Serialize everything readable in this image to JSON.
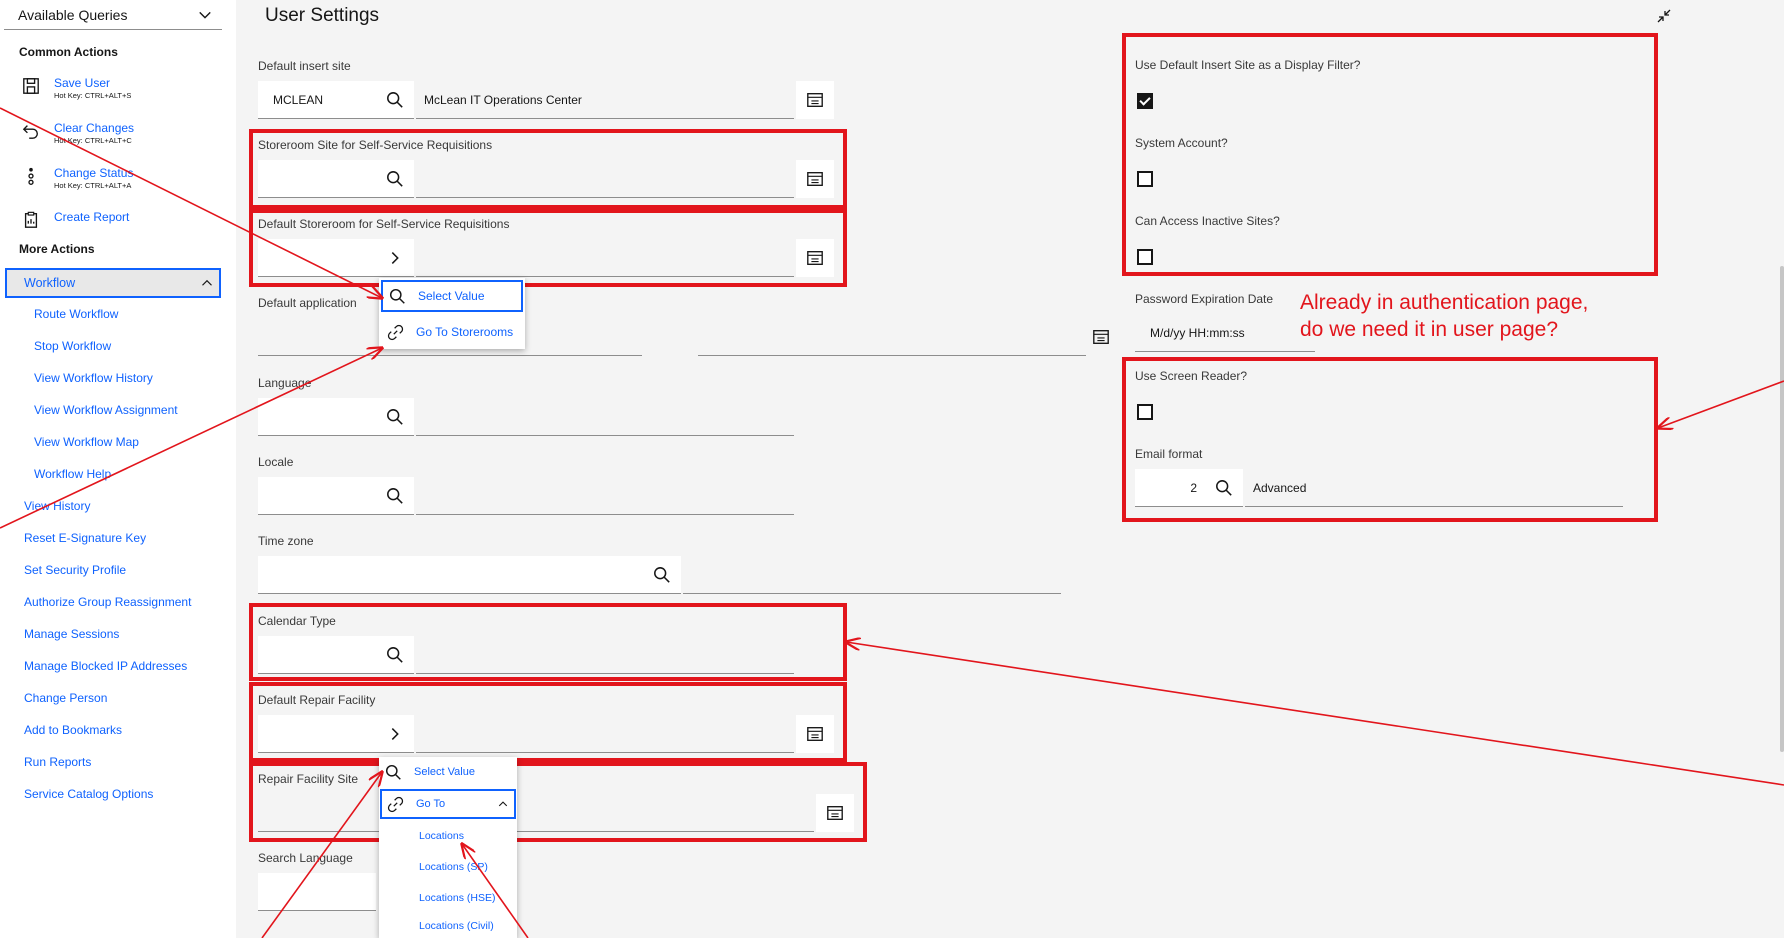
{
  "sidebar": {
    "available_queries": "Available Queries",
    "common_actions_title": "Common Actions",
    "common_actions": [
      {
        "label": "Save User",
        "hotkey": "Hot Key: CTRL+ALT+S",
        "icon": "save-icon"
      },
      {
        "label": "Clear Changes",
        "hotkey": "Hot Key: CTRL+ALT+C",
        "icon": "undo-icon"
      },
      {
        "label": "Change Status",
        "hotkey": "Hot Key: CTRL+ALT+A",
        "icon": "status-icon"
      },
      {
        "label": "Create Report",
        "hotkey": "",
        "icon": "report-icon"
      }
    ],
    "more_actions_title": "More Actions",
    "workflow": {
      "label": "Workflow",
      "items": [
        "Route Workflow",
        "Stop Workflow",
        "View Workflow History",
        "View Workflow Assignment",
        "View Workflow Map",
        "Workflow Help"
      ]
    },
    "more_actions": [
      "View History",
      "Reset E-Signature Key",
      "Set Security Profile",
      "Authorize Group Reassignment",
      "Manage Sessions",
      "Manage Blocked IP Addresses",
      "Change Person",
      "Add to Bookmarks",
      "Run Reports",
      "Service Catalog Options"
    ]
  },
  "main": {
    "title": "User Settings",
    "default_insert_site": {
      "label": "Default insert site",
      "value": "MCLEAN",
      "description": "McLean IT Operations Center"
    },
    "storeroom_site": {
      "label": "Storeroom Site for Self-Service Requisitions",
      "value": ""
    },
    "default_storeroom": {
      "label": "Default Storeroom for Self-Service Requisitions",
      "value": ""
    },
    "default_application": {
      "label": "Default application",
      "value": ""
    },
    "language": {
      "label": "Language",
      "value": ""
    },
    "locale": {
      "label": "Locale",
      "value": ""
    },
    "time_zone": {
      "label": "Time zone",
      "value": ""
    },
    "calendar_type": {
      "label": "Calendar Type",
      "value": ""
    },
    "default_repair_facility": {
      "label": "Default Repair Facility",
      "value": ""
    },
    "repair_facility_site": {
      "label": "Repair Facility Site",
      "value": ""
    },
    "search_language": {
      "label": "Search Language",
      "value": ""
    },
    "storeroom_menu": {
      "select_value": "Select Value",
      "go_to": "Go To Storerooms"
    },
    "repair_menu": {
      "select_value": "Select Value",
      "go_to": "Go To",
      "go_to_items": [
        "Locations",
        "Locations (SP)",
        "Locations (HSE)",
        "Locations (Civil)"
      ]
    },
    "right": {
      "display_filter": {
        "label": "Use Default Insert Site as a Display Filter?",
        "checked": true
      },
      "system_account": {
        "label": "System Account?",
        "checked": false
      },
      "inactive_sites": {
        "label": "Can Access Inactive Sites?",
        "checked": false
      },
      "password_expiration": {
        "label": "Password Expiration Date",
        "placeholder": "M/d/yy HH:mm:ss"
      },
      "screen_reader": {
        "label": "Use Screen Reader?",
        "checked": false
      },
      "email_format": {
        "label": "Email format",
        "value": "2",
        "description": "Advanced"
      }
    },
    "annotation": {
      "line1": "Already in authentication page,",
      "line2": "do we need it in user page?"
    }
  },
  "colors": {
    "accent": "#0f62fe",
    "annotation_red": "#e2151c",
    "background": "#f4f4f4"
  }
}
